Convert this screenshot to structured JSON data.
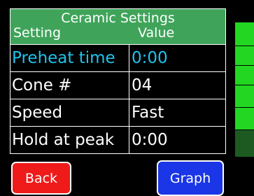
{
  "header": {
    "title": "Ceramic Settings",
    "col_setting": "Setting",
    "col_value": "Value"
  },
  "rows": [
    {
      "setting": "Preheat time",
      "value": "0:00",
      "selected": true
    },
    {
      "setting": "Cone #",
      "value": "04",
      "selected": false
    },
    {
      "setting": "Speed",
      "value": "Fast",
      "selected": false
    },
    {
      "setting": "Hold at peak",
      "value": "0:00",
      "selected": false
    }
  ],
  "buttons": {
    "back_label": "Back",
    "graph_label": "Graph"
  },
  "side_strip": {
    "segments": [
      {
        "name": "level-1",
        "color": "#22d622"
      },
      {
        "name": "level-2",
        "color": "#22d622"
      },
      {
        "name": "level-3",
        "color": "#22d622"
      },
      {
        "name": "level-4",
        "color": "#22d622"
      },
      {
        "name": "level-5",
        "color": "#22d622"
      },
      {
        "name": "level-6",
        "color": "#1d5a22"
      }
    ]
  },
  "colors": {
    "header_bg": "#3fa45a",
    "selected_text": "#1fc3ee",
    "back_button": "#ef1a1a",
    "graph_button": "#1a36e6"
  }
}
